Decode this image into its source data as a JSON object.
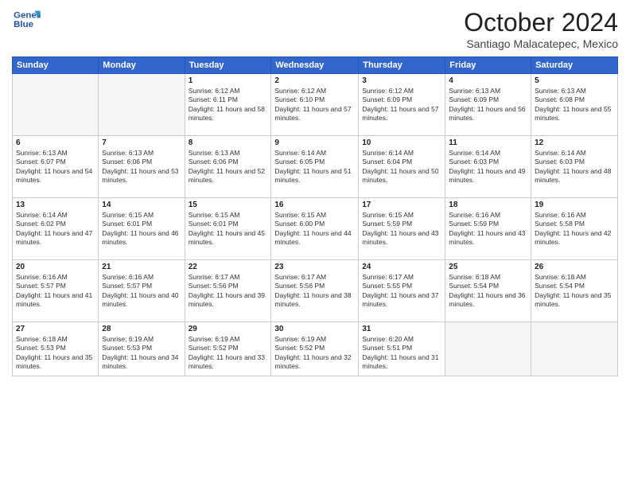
{
  "header": {
    "logo_line1": "General",
    "logo_line2": "Blue",
    "month": "October 2024",
    "location": "Santiago Malacatepec, Mexico"
  },
  "weekdays": [
    "Sunday",
    "Monday",
    "Tuesday",
    "Wednesday",
    "Thursday",
    "Friday",
    "Saturday"
  ],
  "weeks": [
    [
      {
        "day": "",
        "empty": true
      },
      {
        "day": "",
        "empty": true
      },
      {
        "day": "1",
        "sunrise": "6:12 AM",
        "sunset": "6:11 PM",
        "daylight": "11 hours and 58 minutes."
      },
      {
        "day": "2",
        "sunrise": "6:12 AM",
        "sunset": "6:10 PM",
        "daylight": "11 hours and 57 minutes."
      },
      {
        "day": "3",
        "sunrise": "6:12 AM",
        "sunset": "6:09 PM",
        "daylight": "11 hours and 57 minutes."
      },
      {
        "day": "4",
        "sunrise": "6:13 AM",
        "sunset": "6:09 PM",
        "daylight": "11 hours and 56 minutes."
      },
      {
        "day": "5",
        "sunrise": "6:13 AM",
        "sunset": "6:08 PM",
        "daylight": "11 hours and 55 minutes."
      }
    ],
    [
      {
        "day": "6",
        "sunrise": "6:13 AM",
        "sunset": "6:07 PM",
        "daylight": "11 hours and 54 minutes."
      },
      {
        "day": "7",
        "sunrise": "6:13 AM",
        "sunset": "6:06 PM",
        "daylight": "11 hours and 53 minutes."
      },
      {
        "day": "8",
        "sunrise": "6:13 AM",
        "sunset": "6:06 PM",
        "daylight": "11 hours and 52 minutes."
      },
      {
        "day": "9",
        "sunrise": "6:14 AM",
        "sunset": "6:05 PM",
        "daylight": "11 hours and 51 minutes."
      },
      {
        "day": "10",
        "sunrise": "6:14 AM",
        "sunset": "6:04 PM",
        "daylight": "11 hours and 50 minutes."
      },
      {
        "day": "11",
        "sunrise": "6:14 AM",
        "sunset": "6:03 PM",
        "daylight": "11 hours and 49 minutes."
      },
      {
        "day": "12",
        "sunrise": "6:14 AM",
        "sunset": "6:03 PM",
        "daylight": "11 hours and 48 minutes."
      }
    ],
    [
      {
        "day": "13",
        "sunrise": "6:14 AM",
        "sunset": "6:02 PM",
        "daylight": "11 hours and 47 minutes."
      },
      {
        "day": "14",
        "sunrise": "6:15 AM",
        "sunset": "6:01 PM",
        "daylight": "11 hours and 46 minutes."
      },
      {
        "day": "15",
        "sunrise": "6:15 AM",
        "sunset": "6:01 PM",
        "daylight": "11 hours and 45 minutes."
      },
      {
        "day": "16",
        "sunrise": "6:15 AM",
        "sunset": "6:00 PM",
        "daylight": "11 hours and 44 minutes."
      },
      {
        "day": "17",
        "sunrise": "6:15 AM",
        "sunset": "5:59 PM",
        "daylight": "11 hours and 43 minutes."
      },
      {
        "day": "18",
        "sunrise": "6:16 AM",
        "sunset": "5:59 PM",
        "daylight": "11 hours and 43 minutes."
      },
      {
        "day": "19",
        "sunrise": "6:16 AM",
        "sunset": "5:58 PM",
        "daylight": "11 hours and 42 minutes."
      }
    ],
    [
      {
        "day": "20",
        "sunrise": "6:16 AM",
        "sunset": "5:57 PM",
        "daylight": "11 hours and 41 minutes."
      },
      {
        "day": "21",
        "sunrise": "6:16 AM",
        "sunset": "5:57 PM",
        "daylight": "11 hours and 40 minutes."
      },
      {
        "day": "22",
        "sunrise": "6:17 AM",
        "sunset": "5:56 PM",
        "daylight": "11 hours and 39 minutes."
      },
      {
        "day": "23",
        "sunrise": "6:17 AM",
        "sunset": "5:56 PM",
        "daylight": "11 hours and 38 minutes."
      },
      {
        "day": "24",
        "sunrise": "6:17 AM",
        "sunset": "5:55 PM",
        "daylight": "11 hours and 37 minutes."
      },
      {
        "day": "25",
        "sunrise": "6:18 AM",
        "sunset": "5:54 PM",
        "daylight": "11 hours and 36 minutes."
      },
      {
        "day": "26",
        "sunrise": "6:18 AM",
        "sunset": "5:54 PM",
        "daylight": "11 hours and 35 minutes."
      }
    ],
    [
      {
        "day": "27",
        "sunrise": "6:18 AM",
        "sunset": "5:53 PM",
        "daylight": "11 hours and 35 minutes."
      },
      {
        "day": "28",
        "sunrise": "6:19 AM",
        "sunset": "5:53 PM",
        "daylight": "11 hours and 34 minutes."
      },
      {
        "day": "29",
        "sunrise": "6:19 AM",
        "sunset": "5:52 PM",
        "daylight": "11 hours and 33 minutes."
      },
      {
        "day": "30",
        "sunrise": "6:19 AM",
        "sunset": "5:52 PM",
        "daylight": "11 hours and 32 minutes."
      },
      {
        "day": "31",
        "sunrise": "6:20 AM",
        "sunset": "5:51 PM",
        "daylight": "11 hours and 31 minutes."
      },
      {
        "day": "",
        "empty": true
      },
      {
        "day": "",
        "empty": true
      }
    ]
  ],
  "labels": {
    "sunrise": "Sunrise:",
    "sunset": "Sunset:",
    "daylight": "Daylight:"
  }
}
